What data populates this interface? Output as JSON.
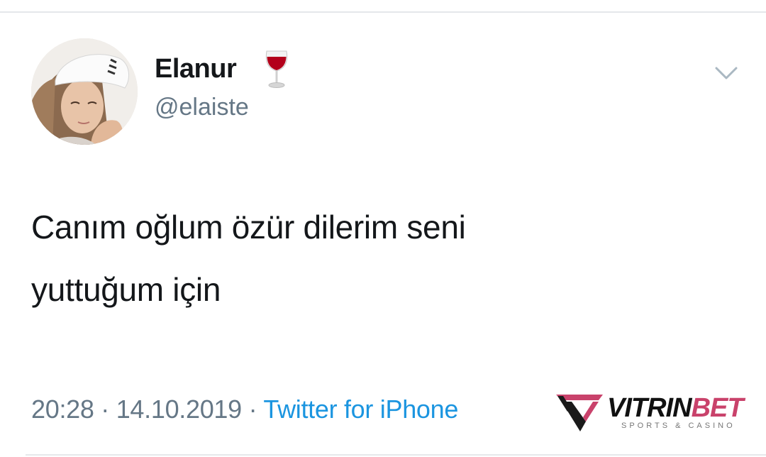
{
  "author": {
    "display_name": "Elanur",
    "handle": "@elaiste",
    "name_emoji_icon": "wine-glass-icon"
  },
  "tweet": {
    "text_lines": [
      "Canım oğlum özür dilerim seni",
      "yuttuğum için"
    ],
    "time": "20:28",
    "separator": "·",
    "date": "14.10.2019",
    "source": "Twitter for iPhone"
  },
  "menu": {
    "icon": "chevron-down-icon"
  },
  "watermark": {
    "brand_part1": "VITRIN",
    "brand_part2": "BET",
    "tagline": "SPORTS & CASINO"
  },
  "colors": {
    "text": "#14171a",
    "secondary": "#657786",
    "link": "#1b95e0",
    "watermark_accent": "#c9426b"
  }
}
